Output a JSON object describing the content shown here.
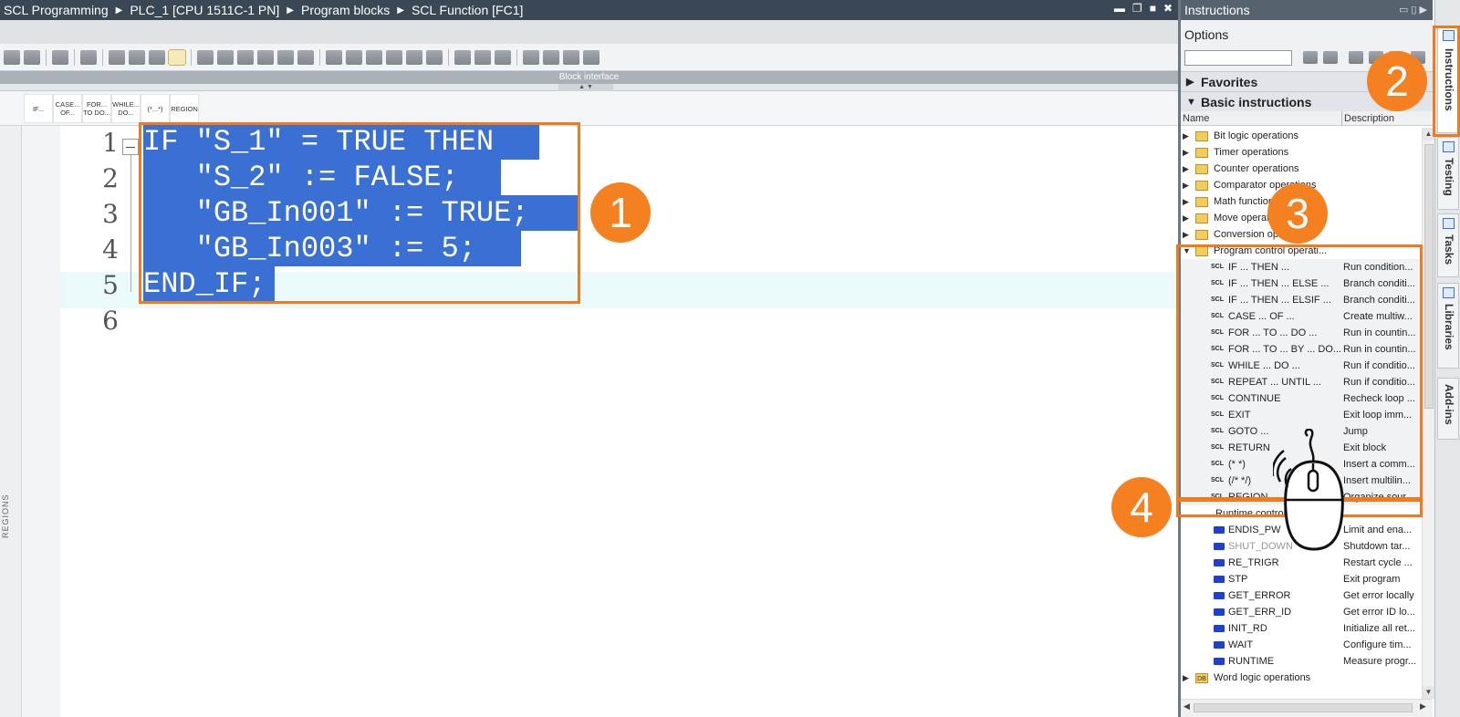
{
  "breadcrumb": [
    "SCL Programming",
    "PLC_1 [CPU 1511C-1 PN]",
    "Program blocks",
    "SCL Function [FC1]"
  ],
  "block_interface_label": "Block interface",
  "scl_buttons": [
    "IF...",
    "CASE... OF...",
    "FOR... TO DO...",
    "WHILE... DO...",
    "(*...*)",
    "REGION"
  ],
  "regions_label": "REGIONS",
  "code_lines": [
    {
      "no": "1",
      "text": "IF \"S_1\" = TRUE THEN "
    },
    {
      "no": "2",
      "text": "   \"S_2\" := FALSE;  "
    },
    {
      "no": "3",
      "text": "   \"GB_In001\" := TRUE;"
    },
    {
      "no": "4",
      "text": "   \"GB_In003\" := 5;  "
    },
    {
      "no": "5",
      "text": "END_IF;"
    },
    {
      "no": "6",
      "text": ""
    }
  ],
  "panel": {
    "title": "Instructions",
    "options_label": "Options",
    "favorites": "Favorites",
    "basic_instructions": "Basic instructions",
    "col_name": "Name",
    "col_description": "Description"
  },
  "tree": [
    {
      "name": "Bit logic operations",
      "desc": "",
      "type": "folder"
    },
    {
      "name": "Timer operations",
      "desc": "",
      "type": "folder"
    },
    {
      "name": "Counter operations",
      "desc": "",
      "type": "folder"
    },
    {
      "name": "Comparator operations",
      "desc": "",
      "type": "folder"
    },
    {
      "name": "Math functions",
      "desc": "",
      "type": "folder"
    },
    {
      "name": "Move operations",
      "desc": "",
      "type": "folder"
    },
    {
      "name": "Conversion operations",
      "desc": "",
      "type": "folder"
    },
    {
      "name": "Program control operati...",
      "desc": "",
      "type": "folder-open"
    },
    {
      "name": "IF ... THEN ...",
      "desc": "Run condition...",
      "type": "scl"
    },
    {
      "name": "IF ... THEN ... ELSE ...",
      "desc": "Branch conditi...",
      "type": "scl"
    },
    {
      "name": "IF ... THEN ... ELSIF ...",
      "desc": "Branch conditi...",
      "type": "scl"
    },
    {
      "name": "CASE ... OF ...",
      "desc": "Create multiw...",
      "type": "scl"
    },
    {
      "name": "FOR ... TO ... DO ...",
      "desc": "Run in countin...",
      "type": "scl"
    },
    {
      "name": "FOR ... TO ... BY ... DO...",
      "desc": "Run in countin...",
      "type": "scl"
    },
    {
      "name": "WHILE ... DO ...",
      "desc": "Run if conditio...",
      "type": "scl"
    },
    {
      "name": "REPEAT ... UNTIL ...",
      "desc": "Run if conditio...",
      "type": "scl"
    },
    {
      "name": "CONTINUE",
      "desc": "Recheck loop ...",
      "type": "scl"
    },
    {
      "name": "EXIT",
      "desc": "Exit loop imm...",
      "type": "scl"
    },
    {
      "name": "GOTO ...",
      "desc": "Jump",
      "type": "scl"
    },
    {
      "name": "RETURN",
      "desc": "Exit block",
      "type": "scl"
    },
    {
      "name": "(*  *)",
      "desc": "Insert a comm...",
      "type": "scl"
    },
    {
      "name": "(/*  */)",
      "desc": "Insert multilin...",
      "type": "scl"
    },
    {
      "name": "REGION",
      "desc": "Organize sour...",
      "type": "scl"
    },
    {
      "name": "Runtime control",
      "desc": "",
      "type": "subheader"
    },
    {
      "name": "ENDIS_PW",
      "desc": "Limit and ena...",
      "type": "blue"
    },
    {
      "name": "SHUT_DOWN",
      "desc": "Shutdown tar...",
      "type": "blue-gray"
    },
    {
      "name": "RE_TRIGR",
      "desc": "Restart cycle ...",
      "type": "blue"
    },
    {
      "name": "STP",
      "desc": "Exit program",
      "type": "blue"
    },
    {
      "name": "GET_ERROR",
      "desc": "Get error locally",
      "type": "blue"
    },
    {
      "name": "GET_ERR_ID",
      "desc": "Get error ID lo...",
      "type": "blue"
    },
    {
      "name": "INIT_RD",
      "desc": "Initialize all ret...",
      "type": "blue"
    },
    {
      "name": "WAIT",
      "desc": "Configure tim...",
      "type": "blue"
    },
    {
      "name": "RUNTIME",
      "desc": "Measure progr...",
      "type": "blue"
    },
    {
      "name": "Word logic operations",
      "desc": "",
      "type": "db"
    }
  ],
  "side_tabs": [
    "Instructions",
    "Testing",
    "Tasks",
    "Libraries",
    "Add-ins"
  ],
  "callouts": [
    "1",
    "2",
    "3",
    "4"
  ],
  "colors": {
    "accent": "#f58020",
    "selection": "#3a6fd4",
    "titlebar": "#3a4754"
  }
}
